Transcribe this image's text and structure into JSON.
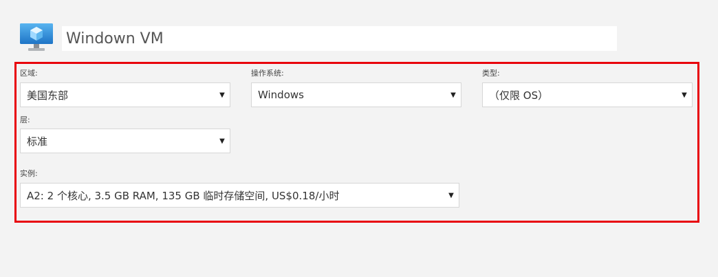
{
  "header": {
    "vm_name_value": "Windown VM",
    "icon": "virtual-machine-icon"
  },
  "form": {
    "region": {
      "label": "区域:",
      "value": "美国东部"
    },
    "os": {
      "label": "操作系统:",
      "value": "Windows"
    },
    "type": {
      "label": "类型:",
      "value": "（仅限 OS）"
    },
    "tier": {
      "label": "层:",
      "value": "标准"
    },
    "instance": {
      "label": "实例:",
      "value": "A2: 2 个核心, 3.5 GB RAM, 135 GB 临时存储空间, US$0.18/小时"
    }
  },
  "colors": {
    "highlight_border": "#e8000b",
    "page_background": "#f3f3f3",
    "icon_blue": "#2f8fd8"
  }
}
